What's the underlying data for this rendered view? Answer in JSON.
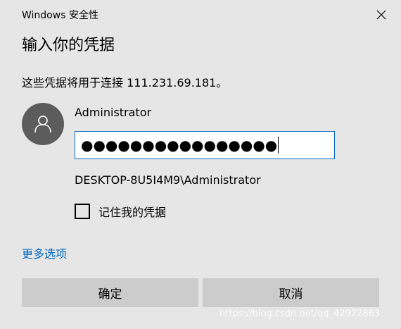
{
  "window": {
    "title": "Windows 安全性"
  },
  "dialog": {
    "heading": "输入你的凭据",
    "description": "这些凭据将用于连接 111.231.69.181。",
    "username": "Administrator",
    "password_masked": "●●●●●●●●●●●●●●●●",
    "domain_user": "DESKTOP-8U5I4M9\\Administrator",
    "remember_label": "记住我的凭据",
    "remember_checked": false,
    "more_options": "更多选项",
    "ok_label": "确定",
    "cancel_label": "取消"
  },
  "watermark": "https://blog.csdn.net/qq_42972863",
  "colors": {
    "background": "#e6e6e6",
    "accent": "#0067c0",
    "button": "#cccccc",
    "avatar": "#5c5c5c"
  },
  "icons": {
    "close": "close-icon",
    "avatar": "user-icon"
  }
}
